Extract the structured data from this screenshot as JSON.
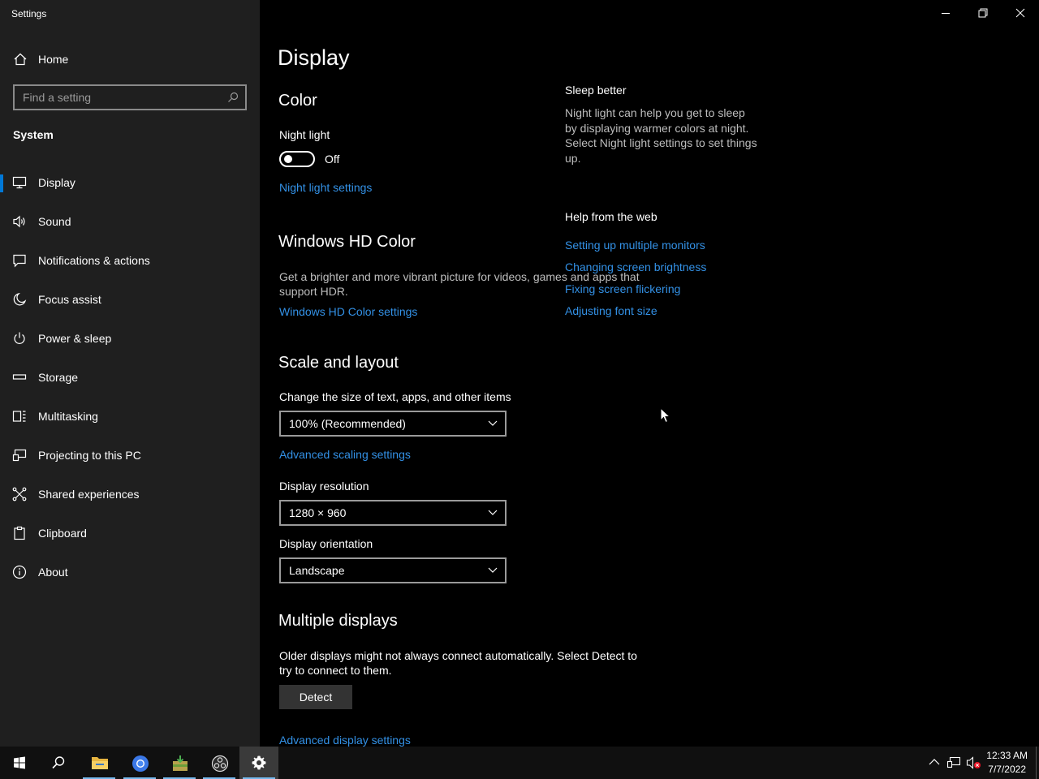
{
  "window": {
    "title": "Settings"
  },
  "sidebar": {
    "home_label": "Home",
    "search_placeholder": "Find a setting",
    "section": "System",
    "items": [
      {
        "label": "Display",
        "icon": "monitor-icon",
        "active": true
      },
      {
        "label": "Sound",
        "icon": "speaker-icon"
      },
      {
        "label": "Notifications & actions",
        "icon": "message-icon"
      },
      {
        "label": "Focus assist",
        "icon": "moon-icon"
      },
      {
        "label": "Power & sleep",
        "icon": "power-icon"
      },
      {
        "label": "Storage",
        "icon": "storage-icon"
      },
      {
        "label": "Multitasking",
        "icon": "multitasking-icon"
      },
      {
        "label": "Projecting to this PC",
        "icon": "projecting-icon"
      },
      {
        "label": "Shared experiences",
        "icon": "shared-icon"
      },
      {
        "label": "Clipboard",
        "icon": "clipboard-icon"
      },
      {
        "label": "About",
        "icon": "info-icon"
      }
    ]
  },
  "main": {
    "title": "Display",
    "color": {
      "heading": "Color",
      "night_light_label": "Night light",
      "night_light_state": "Off",
      "night_light_link": "Night light settings"
    },
    "hd_color": {
      "heading": "Windows HD Color",
      "description": "Get a brighter and more vibrant picture for videos, games and apps that support HDR.",
      "link": "Windows HD Color settings"
    },
    "scale": {
      "heading": "Scale and layout",
      "size_label": "Change the size of text, apps, and other items",
      "size_value": "100% (Recommended)",
      "advanced_link": "Advanced scaling settings",
      "resolution_label": "Display resolution",
      "resolution_value": "1280 × 960",
      "orientation_label": "Display orientation",
      "orientation_value": "Landscape"
    },
    "multiple": {
      "heading": "Multiple displays",
      "description": "Older displays might not always connect automatically. Select Detect to try to connect to them.",
      "detect_label": "Detect",
      "advanced_link": "Advanced display settings"
    }
  },
  "right_pane": {
    "sleep_heading": "Sleep better",
    "sleep_text": "Night light can help you get to sleep by displaying warmer colors at night. Select Night light settings to set things up.",
    "help_heading": "Help from the web",
    "links": [
      "Setting up multiple monitors",
      "Changing screen brightness",
      "Fixing screen flickering",
      "Adjusting font size"
    ]
  },
  "taskbar": {
    "apps": [
      "start-icon",
      "search-icon",
      "file-explorer-icon",
      "chrome-icon",
      "archive-icon",
      "obs-icon",
      "settings-icon"
    ],
    "time": "12:33 AM",
    "date": "7/7/2022"
  },
  "colors": {
    "accent": "#0078d7",
    "link": "#3391e6",
    "sidebar_bg": "#1f1f1f",
    "main_bg": "#000000"
  }
}
